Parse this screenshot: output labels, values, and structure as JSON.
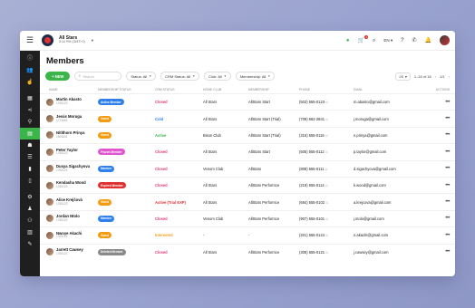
{
  "topbar": {
    "club_name": "All Stars",
    "club_time": "5:10 PM (GMT+2)",
    "language": "EN",
    "cart_badge": "1"
  },
  "page": {
    "title": "Members"
  },
  "toolbar": {
    "new_label": "+ NEW",
    "search_placeholder": "Search",
    "filters": [
      {
        "label": "Status: All"
      },
      {
        "label": "CRM Status: All"
      },
      {
        "label": "Club: All"
      },
      {
        "label": "Membership: All"
      }
    ],
    "page_size": "25",
    "range": "1–16 of 16",
    "page_indicator": "1/1"
  },
  "table": {
    "headers": {
      "name": "NAME",
      "membership_status": "MEMBERSHIP STATUS",
      "crm_status": "CRM STATUS",
      "home_club": "HOME CLUB",
      "membership": "MEMBERSHIP",
      "phone": "PHONE",
      "email": "EMAIL",
      "actions": "ACTIONS"
    },
    "rows": [
      {
        "name": "Martin Abasto",
        "id": "1765123",
        "status": "Active Member",
        "status_color": "#2f80ed",
        "crm": "Closed",
        "crm_color": "#e0357a",
        "club": "All Stars",
        "membership": "AllStars Start",
        "phone": "(503) 555-0123",
        "email": "m.abasto@gmail.com"
      },
      {
        "name": "Jesús Moruga",
        "id": "1774663",
        "status": "Guest",
        "status_color": "#f39c12",
        "crm": "Cold",
        "crm_color": "#2f80ed",
        "club": "All Stars",
        "membership": "AllStars Start (Trial)",
        "phone": "(709) 682-2841",
        "email": "j.moruga@gmail.com"
      },
      {
        "name": "Nitithorn Prinya",
        "id": "1505831",
        "status": "Guest",
        "status_color": "#f39c12",
        "crm": "Active",
        "crm_color": "#3bb54a",
        "club": "Bison Club",
        "membership": "AllStars Start (Trial)",
        "phone": "(316) 555-0116",
        "email": "n.prinya@gmail.com"
      },
      {
        "name": "Peter Taylor",
        "id": "1765123",
        "status": "Frozen Member",
        "status_color": "#e056d0",
        "crm": "Closed",
        "crm_color": "#e0357a",
        "club": "All Stars",
        "membership": "AllStars Start",
        "phone": "(505) 555-0112",
        "email": "p.taylor@gmail.com"
      },
      {
        "name": "Dusya Sigachyova",
        "id": "1765123",
        "status": "Member",
        "status_color": "#2f80ed",
        "crm": "Closed",
        "crm_color": "#e0357a",
        "club": "Venom Club",
        "membership": "AllStars",
        "phone": "(808) 555-0111",
        "email": "d.sigachyova@gmail.com"
      },
      {
        "name": "Kendasha Wood",
        "id": "1765123",
        "status": "Expired Member",
        "status_color": "#e03030",
        "crm": "Closed",
        "crm_color": "#e0357a",
        "club": "All Stars",
        "membership": "AllStars Performce",
        "phone": "(219) 555-0114",
        "email": "k.wood@gmail.com"
      },
      {
        "name": "Alice Krejčová",
        "id": "1765123",
        "status": "Guest",
        "status_color": "#f39c12",
        "crm": "Active (Trial EXP)",
        "crm_color": "#e03030",
        "club": "All Stars",
        "membership": "AllStars Performce",
        "phone": "(684) 555-0102",
        "email": "a.krejcova@gmail.com"
      },
      {
        "name": "Jordan Ntolo",
        "id": "1765123",
        "status": "Member",
        "status_color": "#2f80ed",
        "crm": "Closed",
        "crm_color": "#e0357a",
        "club": "Venom Club",
        "membership": "AllStars Performce",
        "phone": "(907) 555-0101",
        "email": "j.ntolo@gmail.com"
      },
      {
        "name": "Nwoye Akachi",
        "id": "1765123",
        "status": "Guest",
        "status_color": "#f39c12",
        "crm": "Interested",
        "crm_color": "#f0a020",
        "club": "-",
        "membership": "-",
        "phone": "(201) 555-0124",
        "email": "n.akachi@gmail.com"
      },
      {
        "name": "Jarrett Cawsey",
        "id": "1765123",
        "status": "Deleted Member",
        "status_color": "#8a8a8a",
        "crm": "Closed",
        "crm_color": "#e0357a",
        "club": "All Stars",
        "membership": "AllStars Performce",
        "phone": "(308) 555-0121",
        "email": "j.cawsey@gmail.com"
      }
    ]
  },
  "sidebar": {
    "items": [
      {
        "icon": "info-icon",
        "glyph": "ⓘ"
      },
      {
        "icon": "users-icon",
        "glyph": "👥"
      },
      {
        "icon": "lead-icon",
        "glyph": "☝"
      },
      {
        "icon": "calendar-icon",
        "glyph": "▦"
      },
      {
        "icon": "share-icon",
        "glyph": "⋖"
      },
      {
        "icon": "walk-icon",
        "glyph": "⚲"
      },
      {
        "icon": "members-card-icon",
        "glyph": "▤",
        "active": true
      },
      {
        "icon": "group-icon",
        "glyph": "☗"
      },
      {
        "icon": "list-icon",
        "glyph": "☰"
      },
      {
        "icon": "document-icon",
        "glyph": "▮"
      },
      {
        "icon": "file-icon",
        "glyph": "▯"
      },
      {
        "icon": "dumbbell-icon",
        "glyph": "⚙"
      },
      {
        "icon": "kettlebell-icon",
        "glyph": "♟"
      },
      {
        "icon": "people-icon",
        "glyph": "⚇"
      },
      {
        "icon": "report-icon",
        "glyph": "▥"
      },
      {
        "icon": "wrench-icon",
        "glyph": "✎"
      }
    ]
  }
}
